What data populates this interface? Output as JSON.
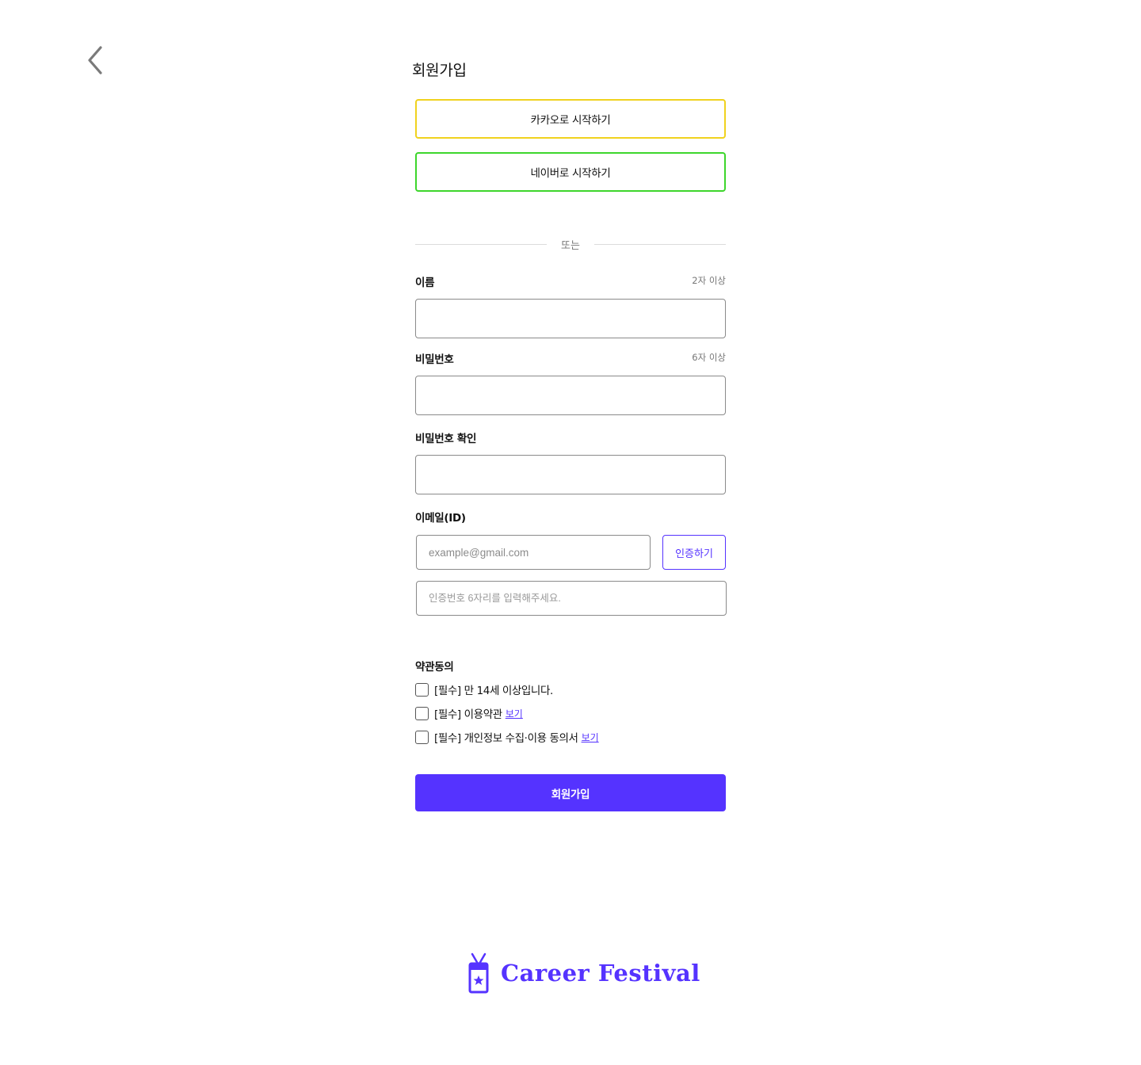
{
  "header": {
    "back_icon": "chevron-left-icon",
    "title": "회원가입"
  },
  "social": {
    "kakao_label": "카카오로 시작하기",
    "kakao_color": "#f0d21e",
    "naver_label": "네이버로 시작하기",
    "naver_color": "#3dd62c"
  },
  "divider_text": "또는",
  "fields": {
    "name": {
      "label": "이름",
      "hint": "2자 이상"
    },
    "password": {
      "label": "비밀번호",
      "hint": "6자 이상"
    },
    "password_confirm": {
      "label": "비밀번호 확인"
    },
    "email": {
      "label": "이메일(ID)",
      "placeholder": "example@gmail.com",
      "verify_label": "인증하기",
      "code_placeholder": "인증번호 6자리를 입력해주세요."
    }
  },
  "terms": {
    "title": "약관동의",
    "items": [
      {
        "text": "[필수] 만 14세 이상입니다.",
        "link": ""
      },
      {
        "text": "[필수] 이용약관",
        "link": "보기"
      },
      {
        "text": "[필수] 개인정보 수집·이용 동의서",
        "link": "보기"
      }
    ]
  },
  "submit_label": "회원가입",
  "brand": {
    "logo_icon": "id-badge-star-icon",
    "name": "Career Festival",
    "accent_color": "#5533ff"
  }
}
